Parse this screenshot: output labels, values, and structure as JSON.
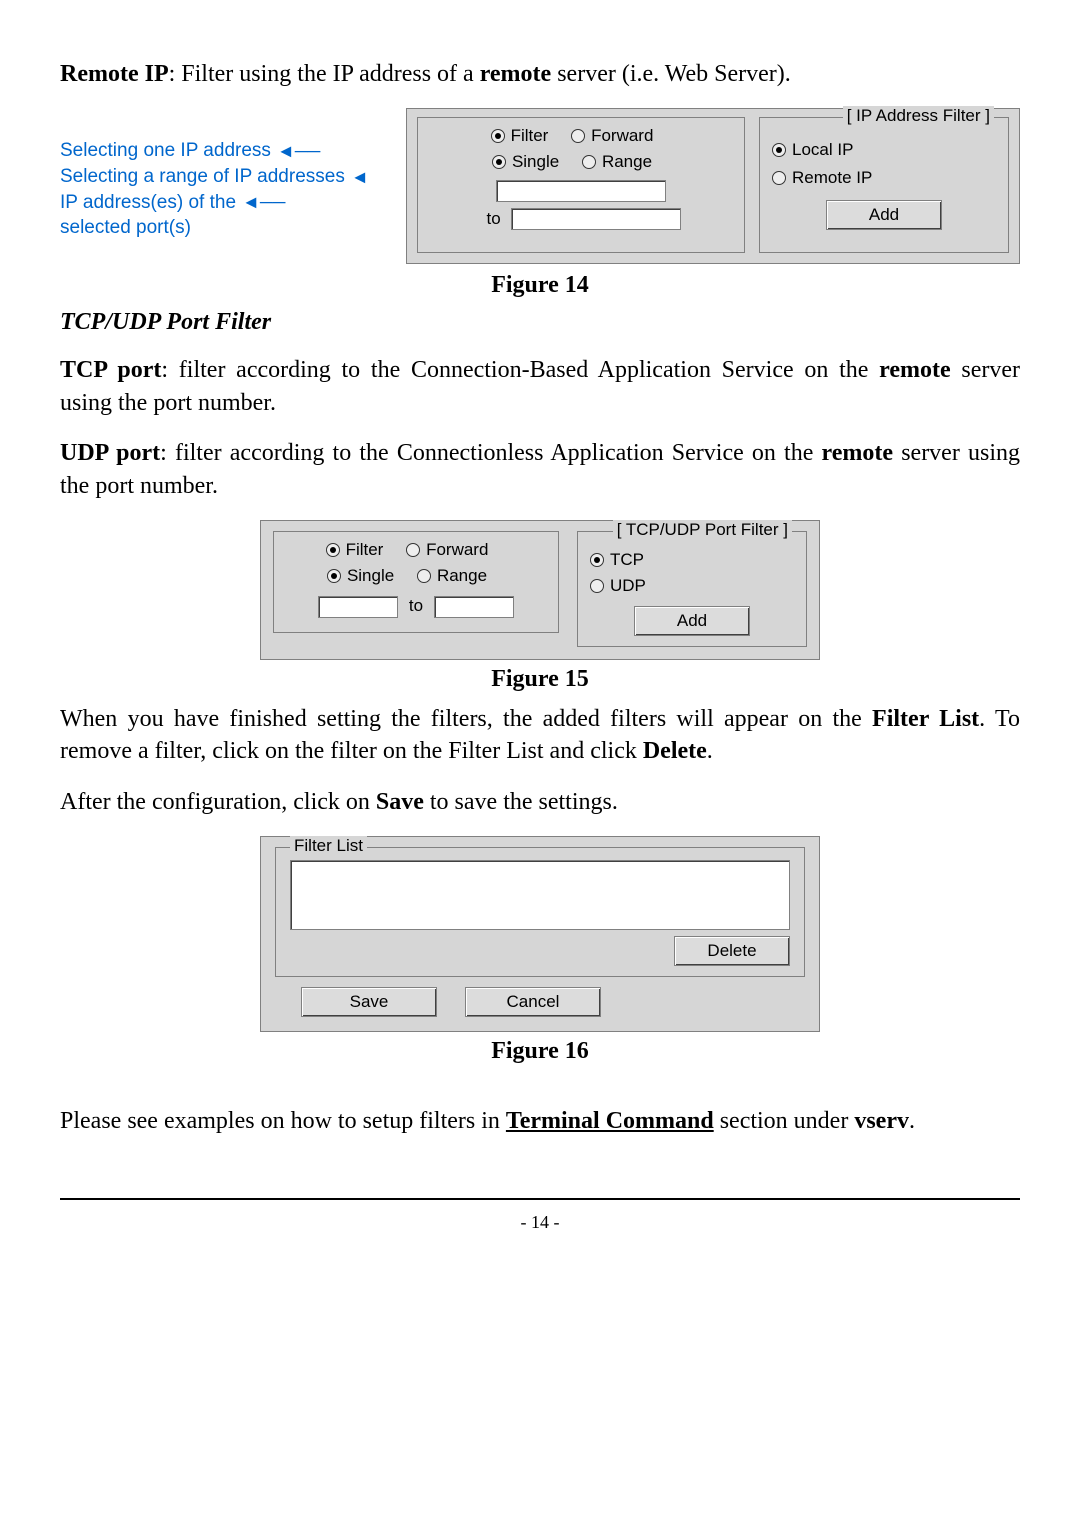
{
  "para": {
    "remote_ip_html": "<span class='b'>Remote IP</span>: Filter using the IP address of a <span class='b'>remote</span> server (i.e. Web Server)."
  },
  "fig14": {
    "annot": {
      "line1": "Selecting one IP address",
      "line2": "Selecting a range of IP addresses",
      "line3": "IP address(es) of the",
      "line4": "selected port(s)"
    },
    "radios": {
      "filter": "Filter",
      "forward": "Forward",
      "single": "Single",
      "range": "Range",
      "local_ip": "Local IP",
      "remote_ip": "Remote IP"
    },
    "to_label": "to",
    "group_title": "IP Address Filter",
    "add_label": "Add",
    "caption": "Figure 14"
  },
  "section": {
    "heading": "TCP/UDP Port Filter",
    "tcp_html": "<span class='b'>TCP port</span>: filter according to the Connection-Based Application Service on the <span class='b'>remote</span> server using the port number.",
    "udp_html": "<span class='b'>UDP port</span>: filter according to the Connectionless Application Service on the <span class='b'>remote</span> server using the port number."
  },
  "fig15": {
    "radios": {
      "filter": "Filter",
      "forward": "Forward",
      "single": "Single",
      "range": "Range",
      "tcp": "TCP",
      "udp": "UDP"
    },
    "to_label": "to",
    "group_title": "TCP/UDP Port Filter",
    "add_label": "Add",
    "caption": "Figure 15"
  },
  "para2": {
    "finished_html": "When you have finished setting the filters, the added filters will appear on the <span class='b'>Filter List</span>. To remove a filter, click on the filter on the Filter List and click <span class='b'>Delete</span>.",
    "after_config_html": "After the configuration, click on <span class='b'>Save</span> to save the settings."
  },
  "fig16": {
    "group_title": "Filter List",
    "delete_label": "Delete",
    "save_label": "Save",
    "cancel_label": "Cancel",
    "caption": "Figure 16"
  },
  "para3": {
    "examples_html": "Please see examples on how to setup filters in <span class='b u'>Terminal Command</span> section under <span class='b'>vserv</span>."
  },
  "page_number": "- 14 -"
}
